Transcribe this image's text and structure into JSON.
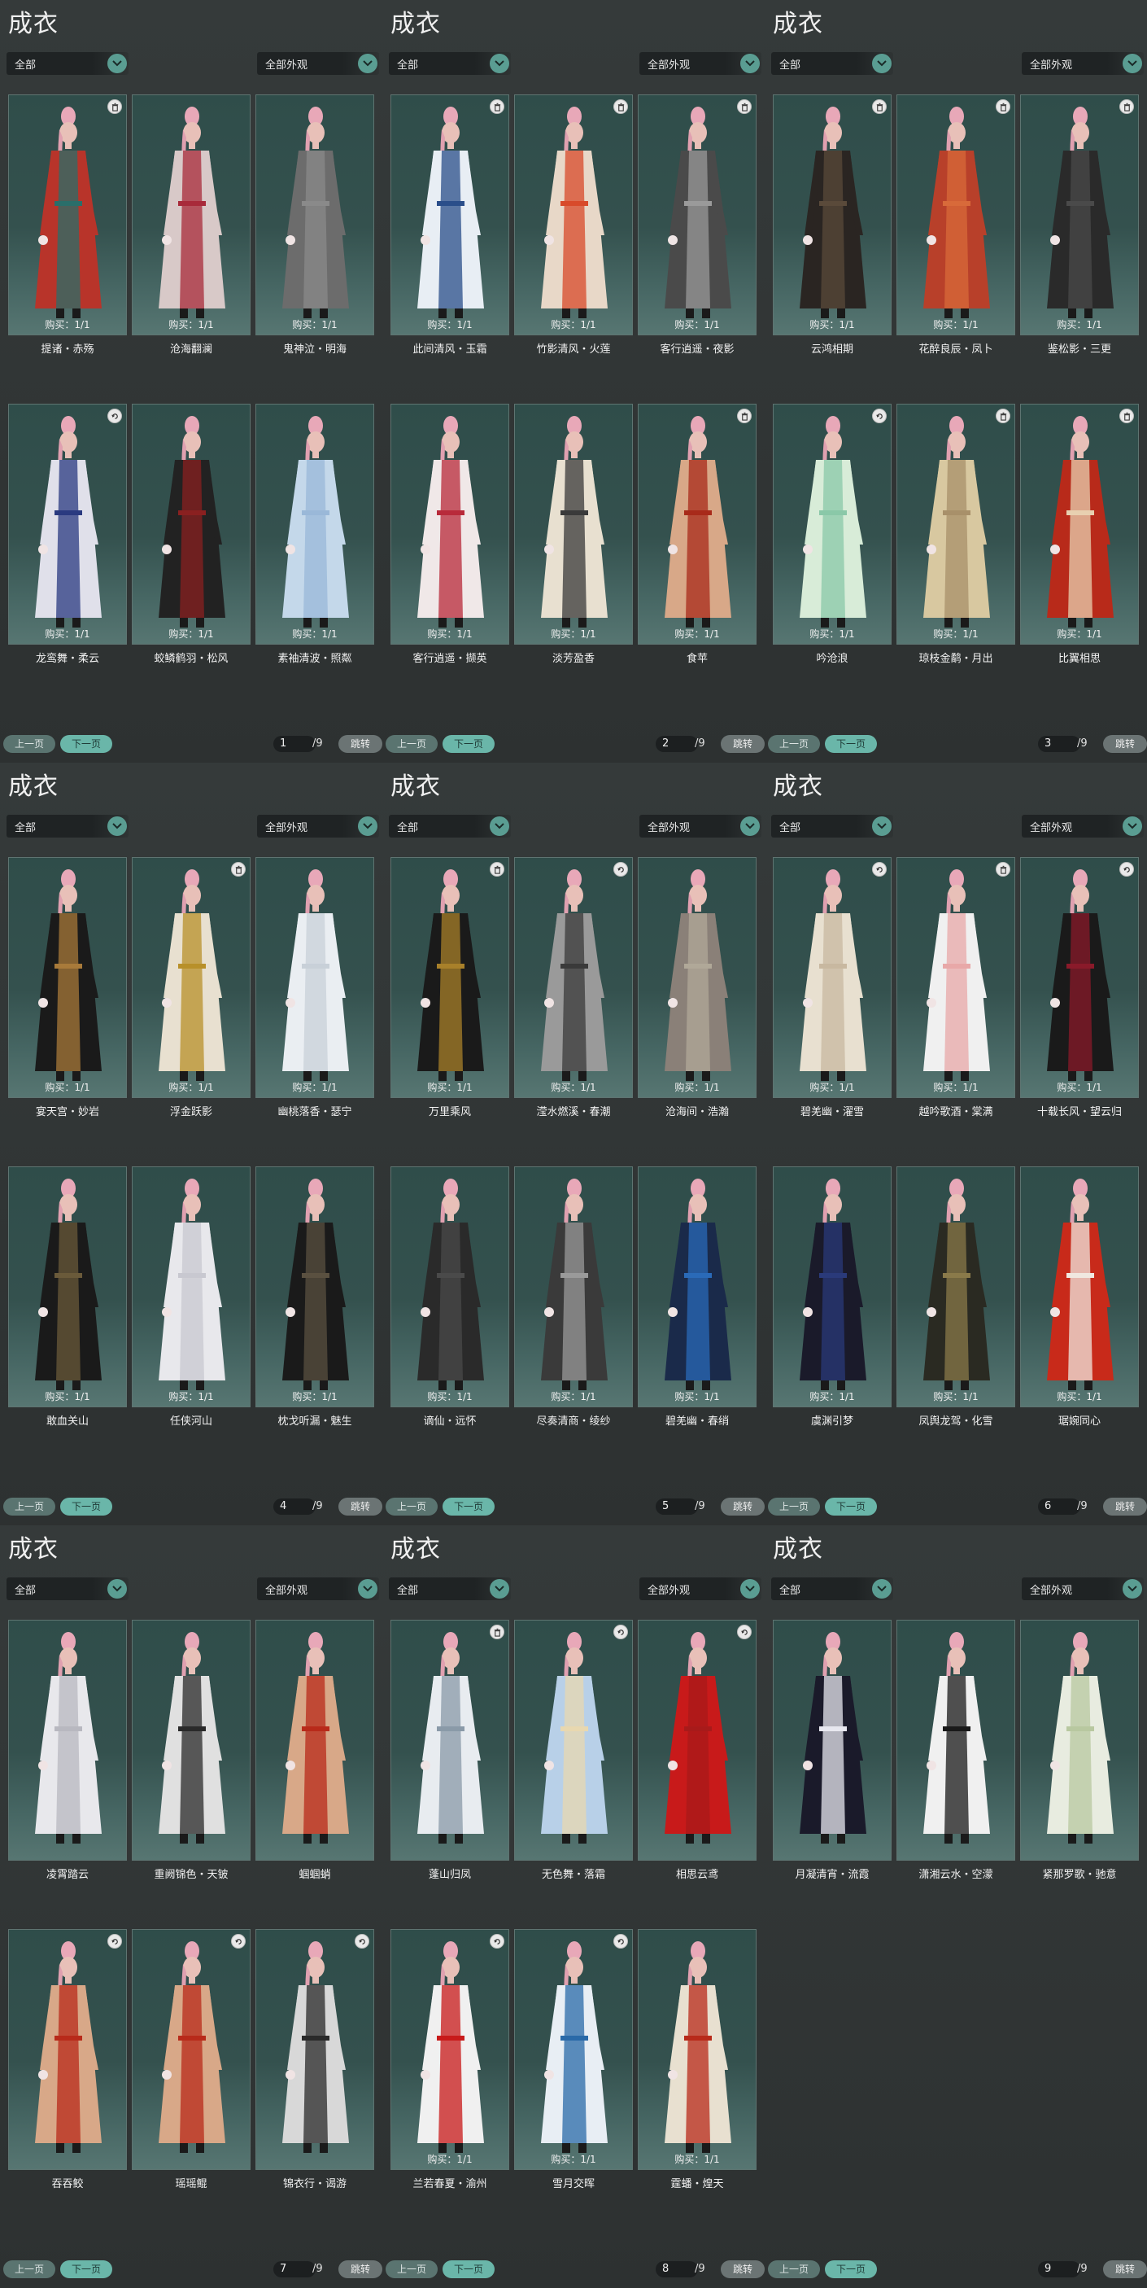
{
  "panels": [
    {
      "title": "成衣",
      "filter1": "全部",
      "filter2": "全部外观",
      "page": "1",
      "total": "/9",
      "prev": "上一页",
      "next": "下一页",
      "jump": "跳转",
      "items": [
        {
          "name": "提诸・赤殇",
          "buy": "购买：1/1",
          "badge": "trash",
          "colors": [
            "#b8342a",
            "#2a6e6a"
          ]
        },
        {
          "name": "沧海翻澜",
          "buy": "购买：1/1",
          "badge": "",
          "colors": [
            "#d8c9c8",
            "#a82a3a"
          ]
        },
        {
          "name": "鬼神泣・明海",
          "buy": "购买：1/1",
          "badge": "",
          "colors": [
            "#6c6c6c",
            "#8a8a8a"
          ]
        },
        {
          "name": "龙鸾舞・柔云",
          "buy": "购买：1/1",
          "badge": "swap",
          "colors": [
            "#e0e0ea",
            "#2a3a80"
          ]
        },
        {
          "name": "蛟鳞鹤羽・松风",
          "buy": "购买：1/1",
          "badge": "",
          "colors": [
            "#222222",
            "#8a2020"
          ]
        },
        {
          "name": "素袖清波・照粼",
          "buy": "购买：1/1",
          "badge": "",
          "colors": [
            "#c4d8ea",
            "#9ab8d8"
          ]
        }
      ]
    },
    {
      "title": "成衣",
      "filter1": "全部",
      "filter2": "全部外观",
      "page": "2",
      "total": "/9",
      "prev": "上一页",
      "next": "下一页",
      "jump": "跳转",
      "items": [
        {
          "name": "此间清风・玉霜",
          "buy": "购买：1/1",
          "badge": "trash",
          "colors": [
            "#e8eef4",
            "#2a4e8a"
          ]
        },
        {
          "name": "竹影清风・火莲",
          "buy": "购买：1/1",
          "badge": "trash",
          "colors": [
            "#e8d8c8",
            "#d84a2a"
          ]
        },
        {
          "name": "客行逍遥・夜影",
          "buy": "购买：1/1",
          "badge": "trash",
          "colors": [
            "#4a4a4a",
            "#9a9a9a"
          ]
        },
        {
          "name": "客行逍遥・撷英",
          "buy": "购买：1/1",
          "badge": "",
          "colors": [
            "#f0e8e8",
            "#b82a3a"
          ]
        },
        {
          "name": "淡芳盈香",
          "buy": "购买：1/1",
          "badge": "",
          "colors": [
            "#e8e0d0",
            "#3a3a3a"
          ]
        },
        {
          "name": "食苹",
          "buy": "购买：1/1",
          "badge": "trash",
          "colors": [
            "#d8a888",
            "#a82a1a"
          ]
        }
      ]
    },
    {
      "title": "成衣",
      "filter1": "全部",
      "filter2": "全部外观",
      "page": "3",
      "total": "/9",
      "prev": "上一页",
      "next": "下一页",
      "jump": "跳转",
      "items": [
        {
          "name": "云鸿相期",
          "buy": "购买：1/1",
          "badge": "trash",
          "colors": [
            "#2a2522",
            "#5a4a3a"
          ]
        },
        {
          "name": "花醉良辰・凤卜",
          "buy": "购买：1/1",
          "badge": "trash",
          "colors": [
            "#b8402a",
            "#d86a3a"
          ]
        },
        {
          "name": "鉴松影・三更",
          "buy": "购买：1/1",
          "badge": "trash",
          "colors": [
            "#2a2a2a",
            "#4a4a4a"
          ]
        },
        {
          "name": "吟沧浪",
          "buy": "购买：1/1",
          "badge": "swap",
          "colors": [
            "#d8ecd8",
            "#8ac8a8"
          ]
        },
        {
          "name": "琼枝金鹬・月出",
          "buy": "购买：1/1",
          "badge": "trash",
          "colors": [
            "#d8c8a0",
            "#a8906a"
          ]
        },
        {
          "name": "比翼相思",
          "buy": "购买：1/1",
          "badge": "trash",
          "colors": [
            "#b82a1a",
            "#e8d0b0"
          ]
        }
      ]
    },
    {
      "title": "成衣",
      "filter1": "全部",
      "filter2": "全部外观",
      "page": "4",
      "total": "/9",
      "prev": "上一页",
      "next": "下一页",
      "jump": "跳转",
      "items": [
        {
          "name": "宴天宫・妙岩",
          "buy": "购买：1/1",
          "badge": "",
          "colors": [
            "#1a1a1a",
            "#a87a3a"
          ]
        },
        {
          "name": "浮金跃影",
          "buy": "购买：1/1",
          "badge": "trash",
          "colors": [
            "#e8e0d0",
            "#b8902a"
          ]
        },
        {
          "name": "幽桃落香・瑟宁",
          "buy": "购买：1/1",
          "badge": "",
          "colors": [
            "#eaeef2",
            "#c8d0d8"
          ]
        },
        {
          "name": "敢血关山",
          "buy": "购买：1/1",
          "badge": "",
          "colors": [
            "#1a1a1a",
            "#6a5a3a"
          ]
        },
        {
          "name": "任侠河山",
          "buy": "购买：1/1",
          "badge": "",
          "colors": [
            "#e8e8ec",
            "#c8c8d0"
          ]
        },
        {
          "name": "枕戈听漏・魅生",
          "buy": "购买：1/1",
          "badge": "",
          "colors": [
            "#1a1a1a",
            "#5a5040"
          ]
        }
      ]
    },
    {
      "title": "成衣",
      "filter1": "全部",
      "filter2": "全部外观",
      "page": "5",
      "total": "/9",
      "prev": "上一页",
      "next": "下一页",
      "jump": "跳转",
      "items": [
        {
          "name": "万里乘风",
          "buy": "购买：1/1",
          "badge": "trash",
          "colors": [
            "#1a1a1a",
            "#a8802a"
          ]
        },
        {
          "name": "滢水燃溪・春潮",
          "buy": "购买：1/1",
          "badge": "swap",
          "colors": [
            "#9a9a9a",
            "#3a3a3a"
          ]
        },
        {
          "name": "沧海间・浩瀚",
          "buy": "购买：1/1",
          "badge": "",
          "colors": [
            "#8a8078",
            "#b0a898"
          ]
        },
        {
          "name": "谪仙・远怀",
          "buy": "购买：1/1",
          "badge": "",
          "colors": [
            "#2a2a2a",
            "#4a4a4a"
          ]
        },
        {
          "name": "尽奏清商・绫纱",
          "buy": "购买：1/1",
          "badge": "",
          "colors": [
            "#3a3a3a",
            "#9a9a9a"
          ]
        },
        {
          "name": "碧羌幽・春绡",
          "buy": "购买：1/1",
          "badge": "",
          "colors": [
            "#1a2a4a",
            "#2a6ab8"
          ]
        }
      ]
    },
    {
      "title": "成衣",
      "filter1": "全部",
      "filter2": "全部外观",
      "page": "6",
      "total": "/9",
      "prev": "上一页",
      "next": "下一页",
      "jump": "跳转",
      "items": [
        {
          "name": "碧羌幽・濯雪",
          "buy": "购买：1/1",
          "badge": "swap",
          "colors": [
            "#e8e0d0",
            "#c8b8a0"
          ]
        },
        {
          "name": "越吟歌酒・棠满",
          "buy": "购买：1/1",
          "badge": "trash",
          "colors": [
            "#f0f0f0",
            "#e8a8a8"
          ]
        },
        {
          "name": "十载长风・望云归",
          "buy": "购买：1/1",
          "badge": "swap",
          "colors": [
            "#1a1a1a",
            "#8a1a2a"
          ]
        },
        {
          "name": "虞渊引梦",
          "buy": "购买：1/1",
          "badge": "",
          "colors": [
            "#1a1a2a",
            "#2a3a7a"
          ]
        },
        {
          "name": "凤舆龙驾・化雪",
          "buy": "购买：1/1",
          "badge": "",
          "colors": [
            "#2a2a22",
            "#8a7a4a"
          ]
        },
        {
          "name": "琚婉同心",
          "buy": "购买：1/1",
          "badge": "",
          "colors": [
            "#c82a1a",
            "#f0e8e0"
          ]
        }
      ]
    },
    {
      "title": "成衣",
      "filter1": "全部",
      "filter2": "全部外观",
      "page": "7",
      "total": "/9",
      "prev": "上一页",
      "next": "下一页",
      "jump": "跳转",
      "items": [
        {
          "name": "凌霄踏云",
          "buy": "",
          "badge": "",
          "colors": [
            "#e8e8ec",
            "#b8b8c0"
          ]
        },
        {
          "name": "重阙锦色・天铍",
          "buy": "",
          "badge": "",
          "colors": [
            "#e0e0e0",
            "#2a2a2a"
          ]
        },
        {
          "name": "蝈蝈蛸",
          "buy": "",
          "badge": "",
          "colors": [
            "#d8a888",
            "#b82a1a"
          ]
        },
        {
          "name": "吞吞鲛",
          "buy": "",
          "badge": "swap",
          "colors": [
            "#d8a888",
            "#b82a1a"
          ]
        },
        {
          "name": "瑶瑶鲲",
          "buy": "",
          "badge": "swap",
          "colors": [
            "#d8a888",
            "#b82a1a"
          ]
        },
        {
          "name": "锦衣行・谒游",
          "buy": "",
          "badge": "swap",
          "colors": [
            "#d8d8d8",
            "#2a2a2a"
          ]
        }
      ]
    },
    {
      "title": "成衣",
      "filter1": "全部",
      "filter2": "全部外观",
      "page": "8",
      "total": "/9",
      "prev": "上一页",
      "next": "下一页",
      "jump": "跳转",
      "items": [
        {
          "name": "蓬山归凤",
          "buy": "",
          "badge": "trash",
          "colors": [
            "#e8ecf0",
            "#8a9aa8"
          ]
        },
        {
          "name": "无色舞・落霜",
          "buy": "",
          "badge": "swap",
          "colors": [
            "#b8d0e8",
            "#e8d8b0"
          ]
        },
        {
          "name": "相思云鸢",
          "buy": "",
          "badge": "swap",
          "colors": [
            "#c81a1a",
            "#a81a1a"
          ]
        },
        {
          "name": "兰若春夏・渝州",
          "buy": "购买：1/1",
          "badge": "swap",
          "colors": [
            "#f0f0f0",
            "#c81a1a"
          ]
        },
        {
          "name": "雪月交晖",
          "buy": "购买：1/1",
          "badge": "swap",
          "colors": [
            "#e8eef4",
            "#2a6aa8"
          ]
        },
        {
          "name": "霆蟠・煌天",
          "buy": "购买：1/1",
          "badge": "",
          "colors": [
            "#e8e0d0",
            "#b82a1a"
          ]
        }
      ]
    },
    {
      "title": "成衣",
      "filter1": "全部",
      "filter2": "全部外观",
      "page": "9",
      "total": "/9",
      "prev": "上一页",
      "next": "下一页",
      "jump": "跳转",
      "items": [
        {
          "name": "月凝清宵・流霞",
          "buy": "",
          "badge": "",
          "colors": [
            "#1a1a2a",
            "#e8e8f0"
          ]
        },
        {
          "name": "潇湘云水・空濛",
          "buy": "",
          "badge": "",
          "colors": [
            "#f0f0f0",
            "#1a1a1a"
          ]
        },
        {
          "name": "紧那罗歌・驰意",
          "buy": "",
          "badge": "",
          "colors": [
            "#e8ece0",
            "#b8c8a0"
          ]
        }
      ]
    }
  ]
}
